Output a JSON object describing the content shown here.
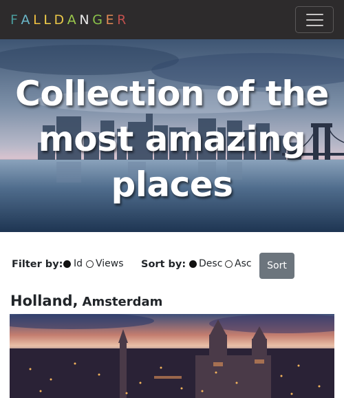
{
  "navbar": {
    "brand_letters": [
      "F",
      "A",
      "L",
      "L",
      "D",
      "A",
      "N",
      "G",
      "E",
      "R"
    ],
    "brand_colors": [
      "#4a9b9b",
      "#6bb7c9",
      "#f0c040",
      "#f4d04a",
      "#e8c548",
      "#9bc94c",
      "#e8e8e8",
      "#8bc34a",
      "#e08a55",
      "#c0504d"
    ],
    "menu_icon": "hamburger-icon"
  },
  "hero": {
    "title": "Collection of the most amazing places",
    "background": "city-skyline-at-dusk-image"
  },
  "filter": {
    "label": "Filter by:",
    "options": [
      {
        "label": "Id",
        "checked": true
      },
      {
        "label": "Views",
        "checked": false
      }
    ]
  },
  "sort": {
    "label": "Sort by:",
    "options": [
      {
        "label": "Desc",
        "checked": true
      },
      {
        "label": "Asc",
        "checked": false
      }
    ],
    "button_label": "Sort"
  },
  "places": [
    {
      "country": "Holland,",
      "city": "Amsterdam",
      "image": "amsterdam-cityscape-image"
    }
  ]
}
